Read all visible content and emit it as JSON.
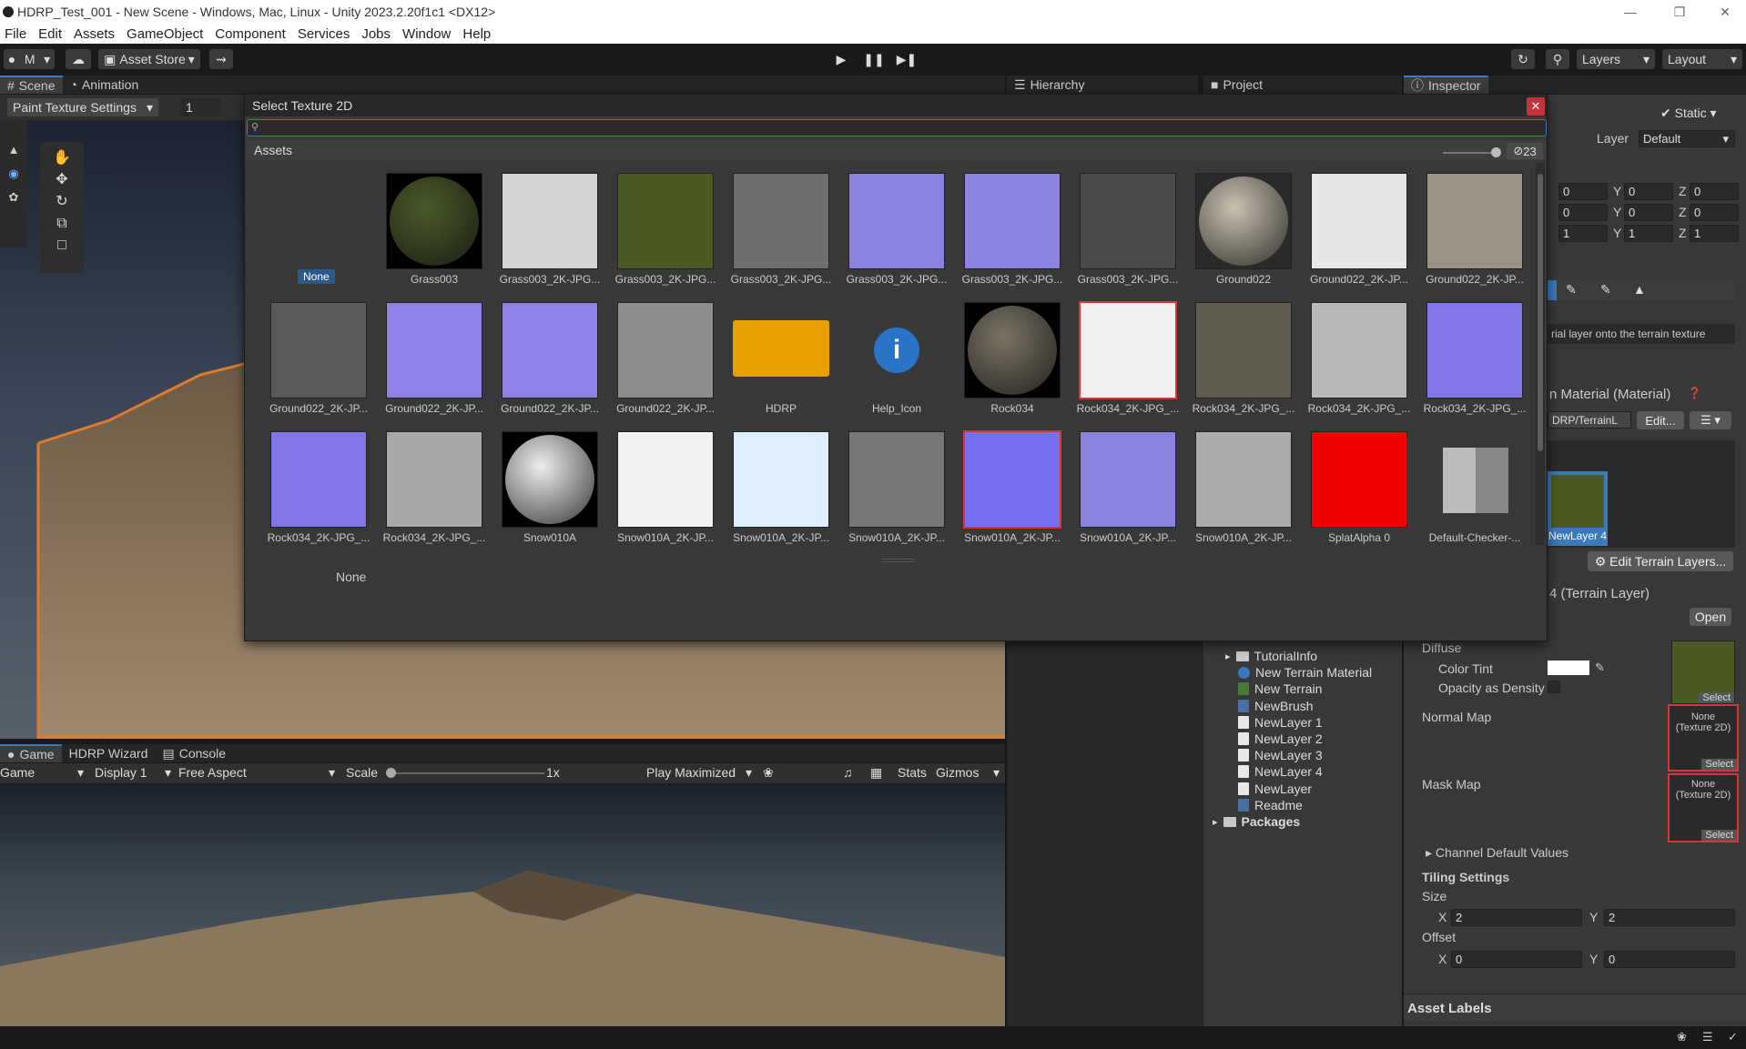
{
  "window": {
    "title": "HDRP_Test_001 - New Scene - Windows, Mac, Linux - Unity 2023.2.20f1c1 <DX12>"
  },
  "menu": [
    "File",
    "Edit",
    "Assets",
    "GameObject",
    "Component",
    "Services",
    "Jobs",
    "Window",
    "Help"
  ],
  "toolbar": {
    "account": "M",
    "asset_store": "Asset Store",
    "layers": "Layers",
    "layout": "Layout"
  },
  "tabs_top": {
    "scene": "Scene",
    "animation": "Animation",
    "hierarchy": "Hierarchy",
    "project": "Project",
    "inspector": "Inspector"
  },
  "scene_toolbar": {
    "paint_mode": "Paint Texture Settings",
    "brush_value": "1"
  },
  "tabs_bottom": {
    "game": "Game",
    "hdrp_wizard": "HDRP Wizard",
    "console": "Console"
  },
  "game_toolbar": {
    "game": "Game",
    "display": "Display 1",
    "aspect": "Free Aspect",
    "scale_label": "Scale",
    "scale_value": "1x",
    "play_mode": "Play Maximized",
    "stats": "Stats",
    "gizmos": "Gizmos"
  },
  "project_tree": [
    {
      "name": "TutorialInfo",
      "type": "folder"
    },
    {
      "name": "New Terrain Material",
      "type": "material"
    },
    {
      "name": "New Terrain",
      "type": "terrain"
    },
    {
      "name": "NewBrush",
      "type": "brush"
    },
    {
      "name": "NewLayer 1",
      "type": "file"
    },
    {
      "name": "NewLayer 2",
      "type": "file"
    },
    {
      "name": "NewLayer 3",
      "type": "file"
    },
    {
      "name": "NewLayer 4",
      "type": "file"
    },
    {
      "name": "NewLayer",
      "type": "file"
    },
    {
      "name": "Readme",
      "type": "readme"
    },
    {
      "name": "Packages",
      "type": "folder"
    }
  ],
  "inspector": {
    "static_label": "Static",
    "layer_label": "Layer",
    "layer_value": "Default",
    "transform": [
      [
        "0",
        "0",
        "0"
      ],
      [
        "0",
        "0",
        "0"
      ],
      [
        "1",
        "1",
        "1"
      ]
    ],
    "paint_hint": "rial layer onto the terrain texture",
    "material_header": "n Material (Material)",
    "shader_value": "DRP/TerrainL",
    "edit_label": "Edit...",
    "layer_thumb_label": "NewLayer 4",
    "edit_terrain_layers": "Edit Terrain Layers...",
    "terrain_layer_header": "4 (Terrain Layer)",
    "open_label": "Open",
    "diffuse": "Diffuse",
    "color_tint": "Color Tint",
    "opacity": "Opacity as Density",
    "normal_map": "Normal Map",
    "mask_map": "Mask Map",
    "none_texture": "None\n(Texture 2D)",
    "select": "Select",
    "channel_defaults": "Channel Default Values",
    "tiling": "Tiling Settings",
    "size": "Size",
    "offset": "Offset",
    "size_x": "2",
    "size_y": "2",
    "offset_x": "0",
    "offset_y": "0",
    "asset_labels": "Asset Labels"
  },
  "dialog": {
    "title": "Select Texture 2D",
    "assets_label": "Assets",
    "hidden_count": "23",
    "none_label": "None",
    "footer_selection": "None",
    "items": [
      {
        "label": "None",
        "style": "none"
      },
      {
        "label": "Grass003",
        "style": "sphere-grass"
      },
      {
        "label": "Grass003_2K-JPG...",
        "style": "light-gray"
      },
      {
        "label": "Grass003_2K-JPG...",
        "style": "grass"
      },
      {
        "label": "Grass003_2K-JPG...",
        "style": "noise-gray"
      },
      {
        "label": "Grass003_2K-JPG...",
        "style": "normal"
      },
      {
        "label": "Grass003_2K-JPG...",
        "style": "normal"
      },
      {
        "label": "Grass003_2K-JPG...",
        "style": "dark-noise"
      },
      {
        "label": "Ground022",
        "style": "sphere-ground"
      },
      {
        "label": "Ground022_2K-JP...",
        "style": "white-noise"
      },
      {
        "label": "Ground022_2K-JP...",
        "style": "ground-color"
      },
      {
        "label": "Ground022_2K-JP...",
        "style": "bw-rocks"
      },
      {
        "label": "Ground022_2K-JP...",
        "style": "normal-bumpy"
      },
      {
        "label": "Ground022_2K-JP...",
        "style": "normal-bumpy"
      },
      {
        "label": "Ground022_2K-JP...",
        "style": "gray-flat"
      },
      {
        "label": "HDRP",
        "style": "hdrp"
      },
      {
        "label": "Help_Icon",
        "style": "help"
      },
      {
        "label": "Rock034",
        "style": "sphere-rock"
      },
      {
        "label": "Rock034_2K-JPG_...",
        "style": "white-selected"
      },
      {
        "label": "Rock034_2K-JPG_...",
        "style": "rock-color"
      },
      {
        "label": "Rock034_2K-JPG_...",
        "style": "bw-cloud"
      },
      {
        "label": "Rock034_2K-JPG_...",
        "style": "normal-rock"
      },
      {
        "label": "Rock034_2K-JPG_...",
        "style": "normal-rock"
      },
      {
        "label": "Rock034_2K-JPG_...",
        "style": "gray-rock"
      },
      {
        "label": "Snow010A",
        "style": "sphere-snow"
      },
      {
        "label": "Snow010A_2K-JP...",
        "style": "snow-white"
      },
      {
        "label": "Snow010A_2K-JP...",
        "style": "snow-blue"
      },
      {
        "label": "Snow010A_2K-JP...",
        "style": "bw-cloud2"
      },
      {
        "label": "Snow010A_2K-JP...",
        "style": "normal-selected"
      },
      {
        "label": "Snow010A_2K-JP...",
        "style": "normal"
      },
      {
        "label": "Snow010A_2K-JP...",
        "style": "gray-mid"
      },
      {
        "label": "SplatAlpha 0",
        "style": "red"
      },
      {
        "label": "Default-Checker-...",
        "style": "checker"
      }
    ]
  }
}
